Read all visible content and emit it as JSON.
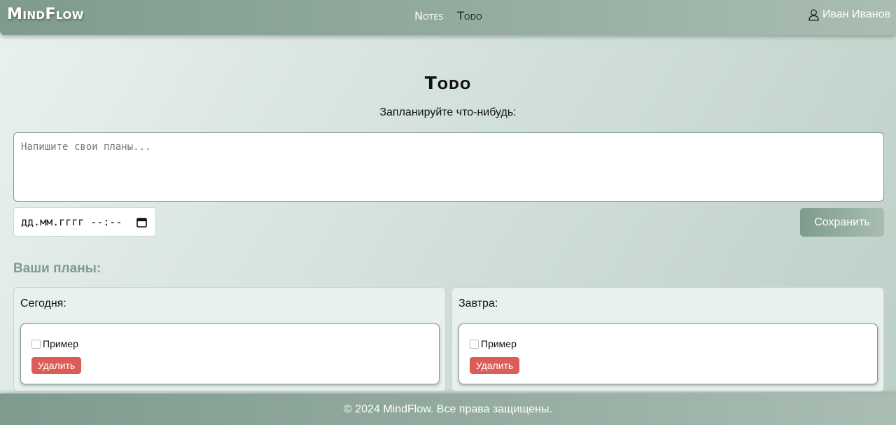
{
  "header": {
    "logo": "MindFlow",
    "nav": [
      "Notes",
      "Todo"
    ],
    "active_nav": "Todo",
    "user_name": "Иван Иванов",
    "user_icon": "user-icon"
  },
  "main": {
    "title": "Todo",
    "subtitle": "Запланируйте что-нибудь:",
    "textarea_placeholder": "Напишите свои планы...",
    "date_placeholder": "дд.мм.гггг --:--",
    "calendar_icon": "calendar-icon",
    "save_label": "Сохранить",
    "plans_heading": "Ваши планы:",
    "days": [
      {
        "label": "Сегодня:",
        "tasks": [
          {
            "text": "Пример",
            "done": false,
            "delete_label": "Удалить"
          }
        ]
      },
      {
        "label": "Завтра:",
        "tasks": [
          {
            "text": "Пример",
            "done": false,
            "delete_label": "Удалить"
          }
        ]
      }
    ]
  },
  "footer": {
    "text": "© 2024 MindFlow. Все права защищены."
  },
  "colors": {
    "accent": "#7f9b8e",
    "danger": "#dc5c58"
  }
}
